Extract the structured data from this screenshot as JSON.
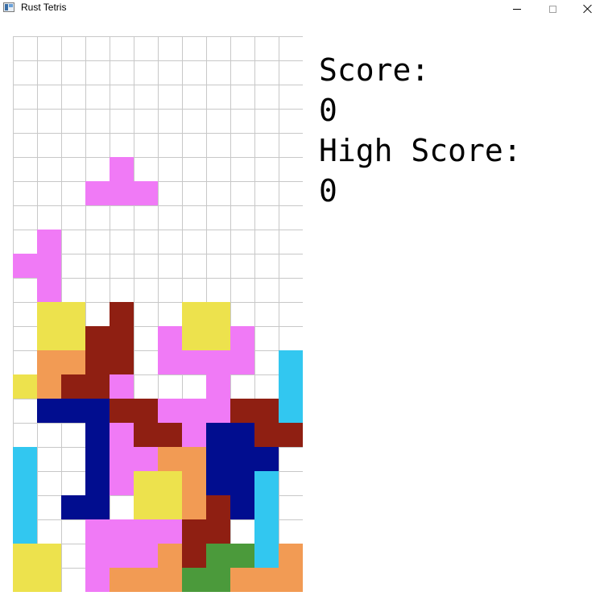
{
  "window": {
    "title": "Rust Tetris",
    "icon": "app-window-icon",
    "controls": [
      "minimize-icon",
      "maximize-icon",
      "close-icon"
    ]
  },
  "palette": {
    "Y": "#ede24d",
    "M": "#f07af6",
    "R": "#8f1f12",
    "O": "#f29b54",
    "B": "#010d8f",
    "C": "#32c7f0",
    "G": "#4b9a3b"
  },
  "board": {
    "columns": 12,
    "rows": 23,
    "cells": [
      "............",
      "............",
      "............",
      "............",
      "............",
      "....M.......",
      "...MMM......",
      "............",
      ".M..........",
      "MM..........",
      ".M..........",
      ".YY.R..YY...",
      ".YYRR.MYYM..",
      ".OORR.MMMM.C",
      "YORRM...M..C",
      ".BBBRRMMMRRC",
      "...BMRRMBBRR",
      "C..BMMOOBBB.",
      "C..BMYYOBBC.",
      "C.BB.YYORBC.",
      "C..MMMMRR.C.",
      "YY.MMMORGGCO",
      "YY.MOOOGGOOO"
    ]
  },
  "score_panel": {
    "score_label": "Score:",
    "score_value": "0",
    "high_score_label": "High Score:",
    "high_score_value": "0"
  }
}
